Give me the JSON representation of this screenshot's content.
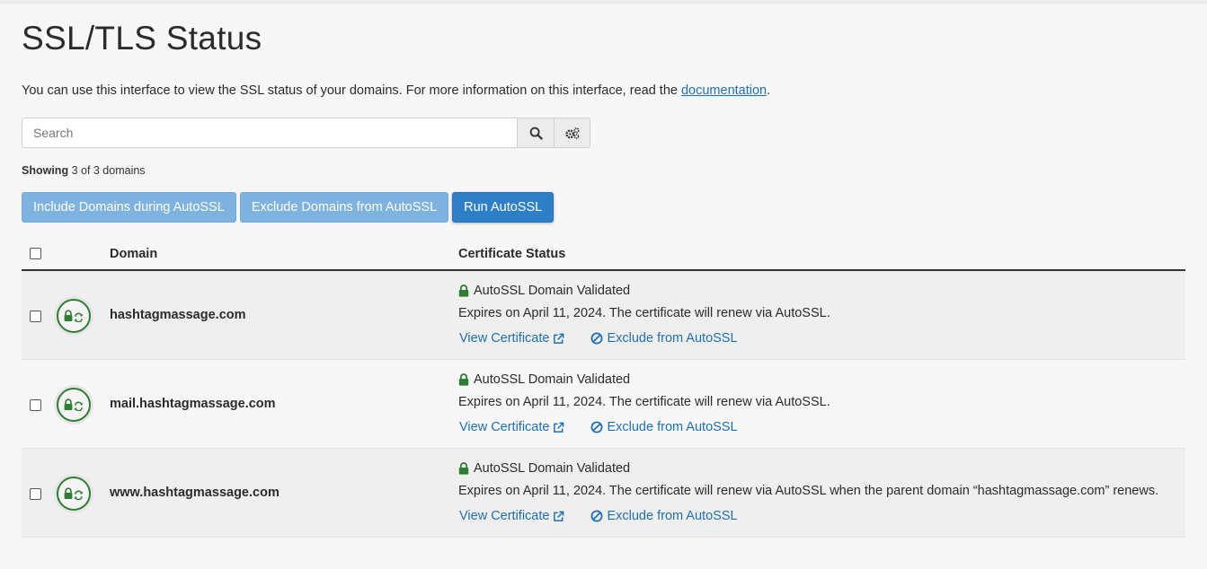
{
  "page": {
    "title": "SSL/TLS Status",
    "intro_text": "You can use this interface to view the SSL status of your domains. For more information on this interface, read the ",
    "intro_link": "documentation",
    "intro_end": "."
  },
  "search": {
    "placeholder": "Search",
    "search_icon": "search-icon",
    "settings_icon": "gears-icon"
  },
  "showing": {
    "label": "Showing",
    "text": "3 of 3 domains"
  },
  "actions": {
    "include": "Include Domains during AutoSSL",
    "exclude": "Exclude Domains from AutoSSL",
    "run": "Run AutoSSL"
  },
  "table": {
    "headers": {
      "domain": "Domain",
      "status": "Certificate Status"
    },
    "rows": [
      {
        "domain": "hashtagmassage.com",
        "status": "AutoSSL Domain Validated",
        "expires": "Expires on April 11, 2024. The certificate will renew via AutoSSL.",
        "view": "View Certificate",
        "exclude": "Exclude from AutoSSL"
      },
      {
        "domain": "mail.hashtagmassage.com",
        "status": "AutoSSL Domain Validated",
        "expires": "Expires on April 11, 2024. The certificate will renew via AutoSSL.",
        "view": "View Certificate",
        "exclude": "Exclude from AutoSSL"
      },
      {
        "domain": "www.hashtagmassage.com",
        "status": "AutoSSL Domain Validated",
        "expires": "Expires on April 11, 2024. The certificate will renew via AutoSSL when the parent domain “hashtagmassage.com” renews.",
        "view": "View Certificate",
        "exclude": "Exclude from AutoSSL"
      }
    ]
  },
  "colors": {
    "link": "#1f6fb4",
    "success_green": "#2e7d32",
    "primary_button": "#2f7fc8",
    "light_button": "#7fb3df"
  }
}
